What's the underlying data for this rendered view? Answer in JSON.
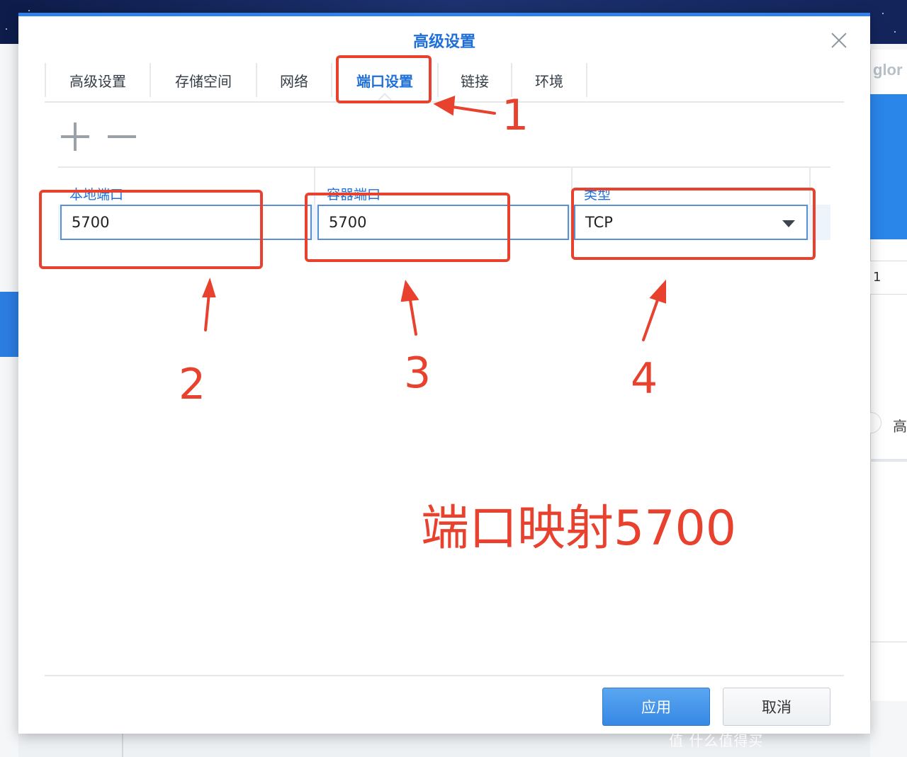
{
  "background": {
    "right_window_text": "glor",
    "right_field_value": "1",
    "right_radio_label": "高",
    "watermark": "值 什么值得买"
  },
  "dialog": {
    "title": "高级设置",
    "tabs": [
      {
        "label": "高级设置",
        "active": false
      },
      {
        "label": "存储空间",
        "active": false
      },
      {
        "label": "网络",
        "active": false
      },
      {
        "label": "端口设置",
        "active": true
      },
      {
        "label": "链接",
        "active": false
      },
      {
        "label": "环境",
        "active": false
      }
    ],
    "toolbar": {
      "add_icon": "plus-icon",
      "remove_icon": "minus-icon"
    },
    "table": {
      "columns": [
        "本地端口",
        "容器端口",
        "类型"
      ],
      "rows": [
        {
          "local_port": "5700",
          "container_port": "5700",
          "type": "TCP"
        }
      ]
    },
    "buttons": {
      "apply": "应用",
      "cancel": "取消"
    }
  },
  "annotations": {
    "numbers": [
      "1",
      "2",
      "3",
      "4"
    ],
    "caption": "端口映射5700",
    "color": "#e8412e"
  },
  "colors": {
    "accent": "#1f6fd8",
    "primary_button": "#3688e4"
  }
}
